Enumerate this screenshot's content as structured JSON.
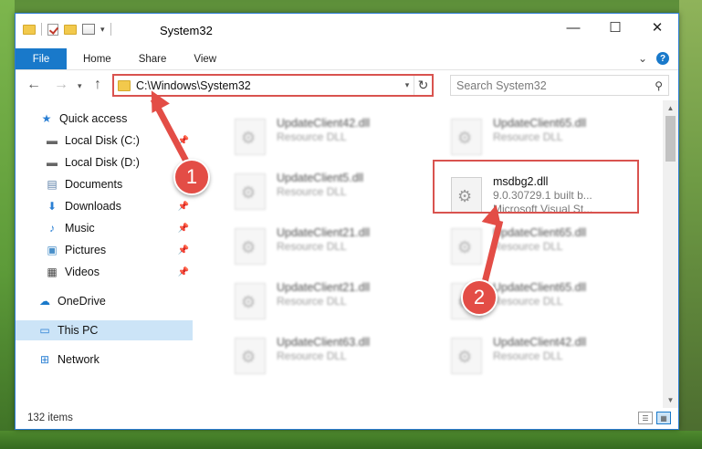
{
  "window": {
    "title": "System32",
    "controls": {
      "minimize": "—",
      "maximize": "☐",
      "close": "✕"
    }
  },
  "ribbon": {
    "tabs": [
      "File",
      "Home",
      "Share",
      "View"
    ],
    "expand": "⌄",
    "help": "?"
  },
  "address": {
    "path": "C:\\Windows\\System32",
    "search_placeholder": "Search System32"
  },
  "sidebar": {
    "items": [
      {
        "label": "Quick access",
        "icon": "star-icon",
        "pinned": false
      },
      {
        "label": "Local Disk (C:)",
        "icon": "drive-icon",
        "pinned": true
      },
      {
        "label": "Local Disk (D:)",
        "icon": "drive-icon",
        "pinned": false
      },
      {
        "label": "Documents",
        "icon": "documents-icon",
        "pinned": true
      },
      {
        "label": "Downloads",
        "icon": "download-icon",
        "pinned": true
      },
      {
        "label": "Music",
        "icon": "music-icon",
        "pinned": true
      },
      {
        "label": "Pictures",
        "icon": "pictures-icon",
        "pinned": true
      },
      {
        "label": "Videos",
        "icon": "videos-icon",
        "pinned": true
      },
      {
        "label": "OneDrive",
        "icon": "cloud-icon",
        "pinned": false
      },
      {
        "label": "This PC",
        "icon": "computer-icon",
        "pinned": false,
        "selected": true
      },
      {
        "label": "Network",
        "icon": "network-icon",
        "pinned": false
      }
    ]
  },
  "files": {
    "left_column": [
      {
        "name": "UpdateClient42.dll",
        "desc": "Resource DLL"
      },
      {
        "name": "UpdateClient5.dll",
        "desc": "Resource DLL"
      },
      {
        "name": "UpdateClient21.dll",
        "desc": "Resource DLL"
      },
      {
        "name": "UpdateClient21.dll",
        "desc": "Resource DLL"
      },
      {
        "name": "UpdateClient63.dll",
        "desc": "Resource DLL"
      }
    ],
    "right_column": [
      {
        "name": "UpdateClient65.dll",
        "desc": "Resource DLL"
      },
      {
        "name": "UpdateClient65.dll",
        "desc": "Resource DLL"
      },
      {
        "name": "UpdateClient65.dll",
        "desc": "Resource DLL"
      },
      {
        "name": "UpdateClient42.dll",
        "desc": "Resource DLL"
      }
    ],
    "highlighted": {
      "name": "msdbg2.dll",
      "line2": "9.0.30729.1 built b...",
      "line3": "Microsoft Visual St..."
    }
  },
  "status": {
    "count": "132 items"
  },
  "annotations": {
    "step1": "1",
    "step2": "2",
    "color": "#e34d46"
  }
}
